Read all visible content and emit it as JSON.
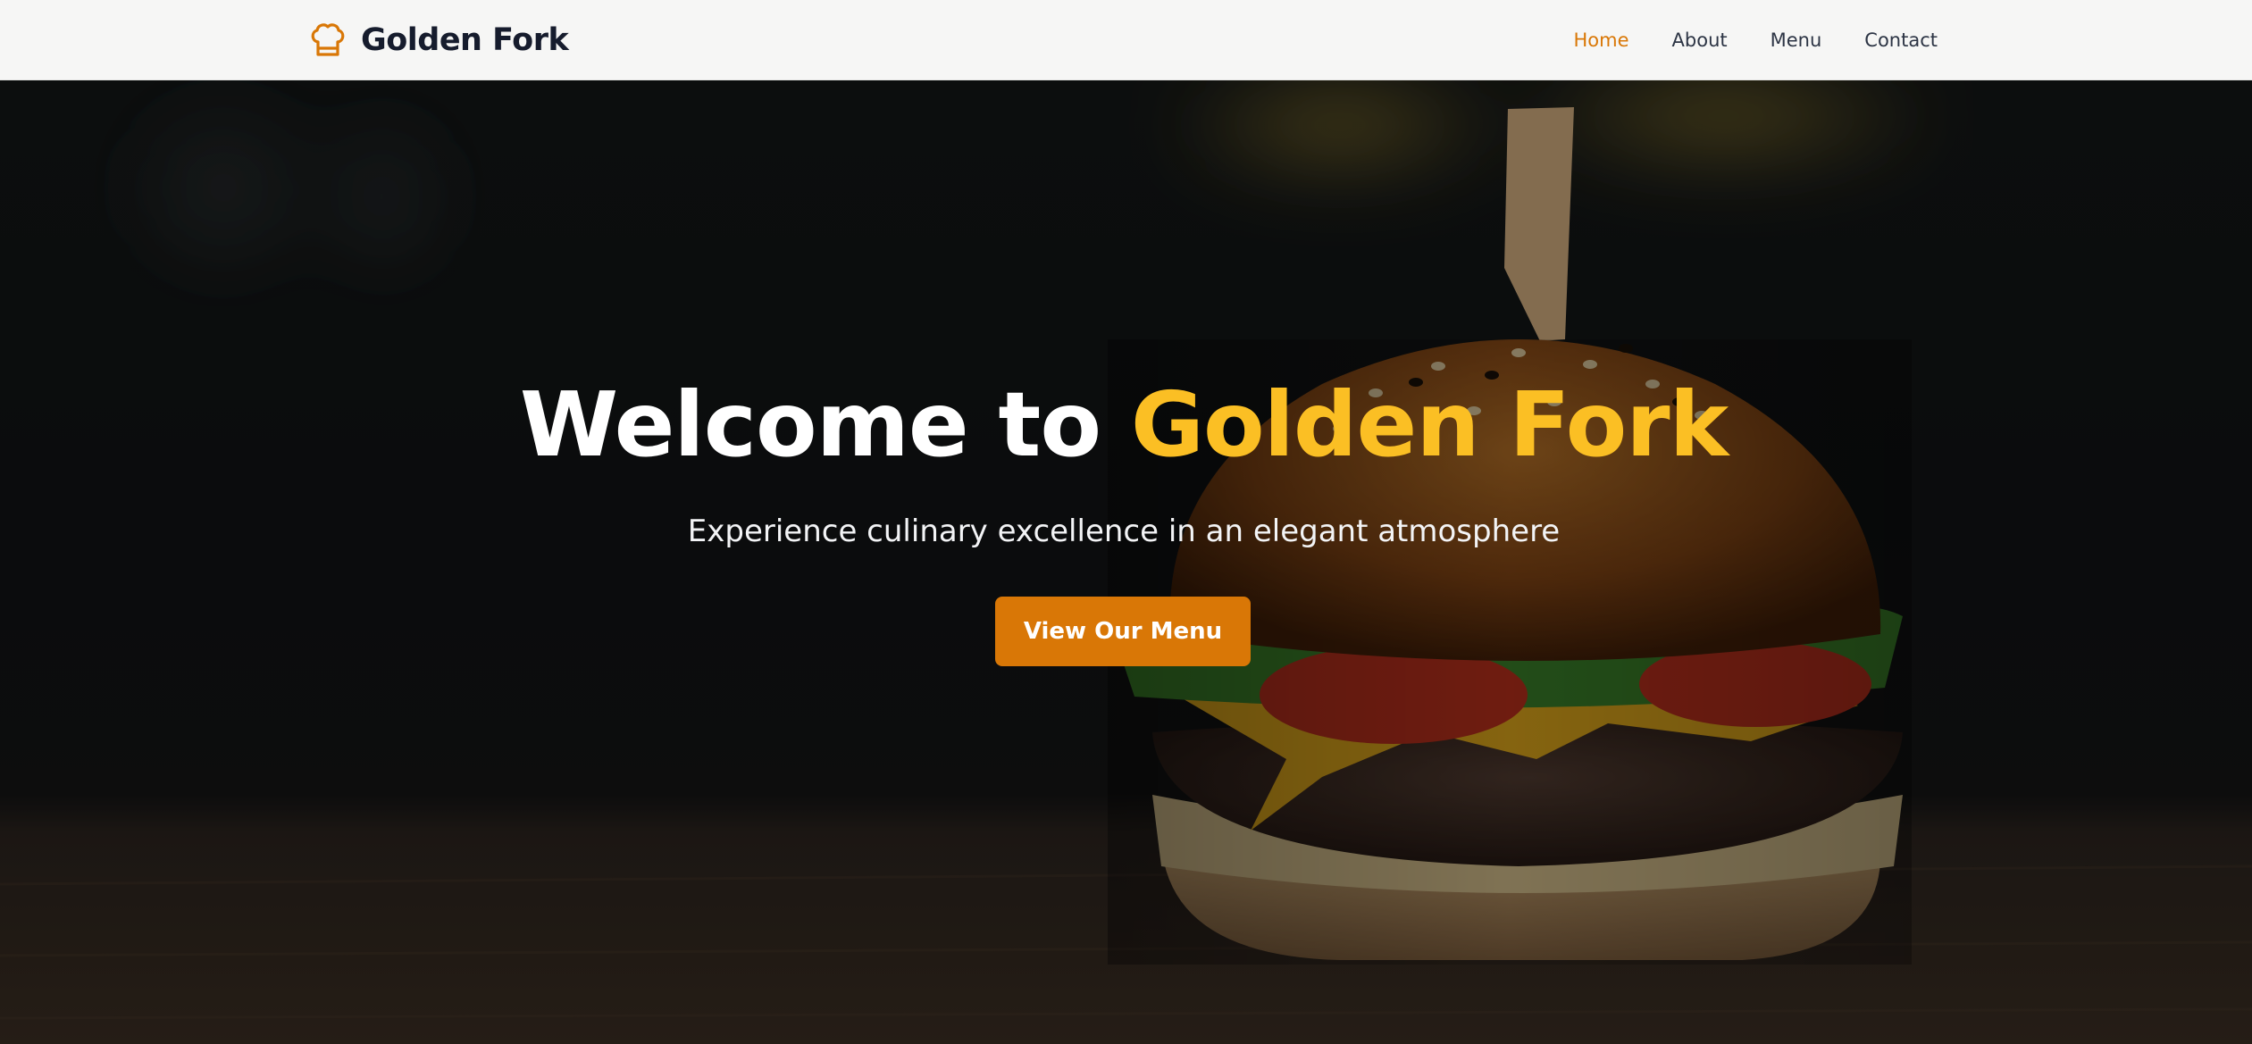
{
  "header": {
    "brand_name": "Golden Fork",
    "brand_icon": "chef-hat-icon",
    "nav": [
      {
        "label": "Home",
        "active": true
      },
      {
        "label": "About",
        "active": false
      },
      {
        "label": "Menu",
        "active": false
      },
      {
        "label": "Contact",
        "active": false
      }
    ]
  },
  "hero": {
    "title_prefix": "Welcome to ",
    "title_highlight": "Golden Fork",
    "subtitle": "Experience culinary excellence in an elegant atmosphere",
    "cta_label": "View Our Menu",
    "background_image": "burger-photo"
  },
  "colors": {
    "accent": "#d97706",
    "highlight": "#fbbf24",
    "header_bg": "#f6f6f5",
    "brand_text": "#161c2d",
    "nav_text": "#2c3444"
  }
}
